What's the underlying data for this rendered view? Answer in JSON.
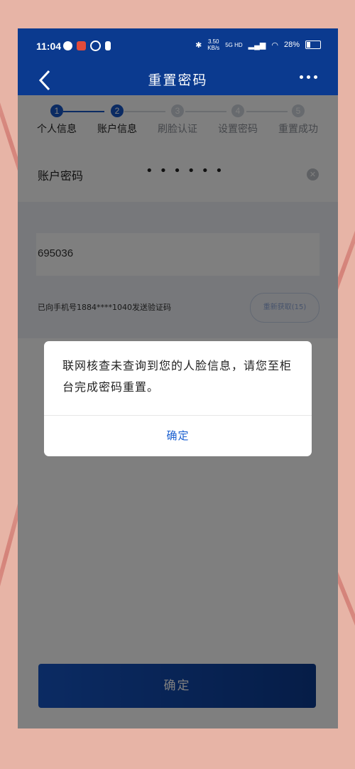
{
  "status_bar": {
    "time": "11:04",
    "net_speed_value": "3.50",
    "net_speed_unit": "KB/s",
    "network_type": "5G HD",
    "battery": "28%"
  },
  "nav": {
    "title": "重置密码"
  },
  "steps": [
    {
      "number": "1",
      "label": "个人信息",
      "state": "done"
    },
    {
      "number": "2",
      "label": "账户信息",
      "state": "current"
    },
    {
      "number": "3",
      "label": "刷脸认证",
      "state": "pending"
    },
    {
      "number": "4",
      "label": "设置密码",
      "state": "pending"
    },
    {
      "number": "5",
      "label": "重置成功",
      "state": "pending"
    }
  ],
  "form": {
    "password_label": "账户密码",
    "password_mask": "••••••",
    "code_value": "695036",
    "sms_hint": "已向手机号1884****1040发送验证码",
    "resend_label": "重新获取(15)",
    "confirm_label": "确定"
  },
  "dialog": {
    "message": "联网核查未查询到您的人脸信息，请您至柜台完成密码重置。",
    "ok_label": "确定"
  },
  "colors": {
    "primary": "#0b3a8f",
    "accent": "#1756c6",
    "dialog_link": "#1a5fd0"
  }
}
